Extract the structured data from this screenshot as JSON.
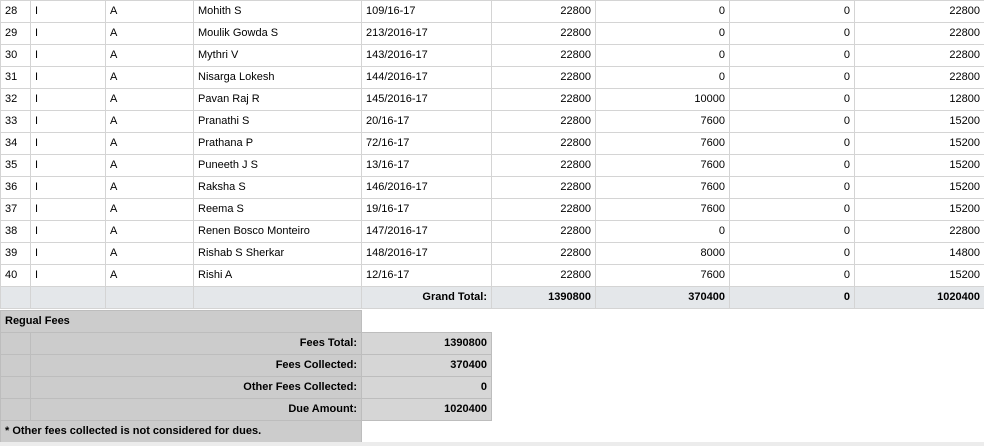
{
  "rows": [
    {
      "sl": "28",
      "cls": "I",
      "sec": "A",
      "name": "Mohith S",
      "adm": "109/16-17",
      "total": "22800",
      "paid": "0",
      "other": "0",
      "due": "22800"
    },
    {
      "sl": "29",
      "cls": "I",
      "sec": "A",
      "name": "Moulik Gowda S",
      "adm": "213/2016-17",
      "total": "22800",
      "paid": "0",
      "other": "0",
      "due": "22800"
    },
    {
      "sl": "30",
      "cls": "I",
      "sec": "A",
      "name": "Mythri V",
      "adm": "143/2016-17",
      "total": "22800",
      "paid": "0",
      "other": "0",
      "due": "22800"
    },
    {
      "sl": "31",
      "cls": "I",
      "sec": "A",
      "name": "Nisarga Lokesh",
      "adm": "144/2016-17",
      "total": "22800",
      "paid": "0",
      "other": "0",
      "due": "22800"
    },
    {
      "sl": "32",
      "cls": "I",
      "sec": "A",
      "name": "Pavan Raj R",
      "adm": "145/2016-17",
      "total": "22800",
      "paid": "10000",
      "other": "0",
      "due": "12800"
    },
    {
      "sl": "33",
      "cls": "I",
      "sec": "A",
      "name": "Pranathi S",
      "adm": "20/16-17",
      "total": "22800",
      "paid": "7600",
      "other": "0",
      "due": "15200"
    },
    {
      "sl": "34",
      "cls": "I",
      "sec": "A",
      "name": "Prathana P",
      "adm": "72/16-17",
      "total": "22800",
      "paid": "7600",
      "other": "0",
      "due": "15200"
    },
    {
      "sl": "35",
      "cls": "I",
      "sec": "A",
      "name": "Puneeth J S",
      "adm": "13/16-17",
      "total": "22800",
      "paid": "7600",
      "other": "0",
      "due": "15200"
    },
    {
      "sl": "36",
      "cls": "I",
      "sec": "A",
      "name": "Raksha S",
      "adm": "146/2016-17",
      "total": "22800",
      "paid": "7600",
      "other": "0",
      "due": "15200"
    },
    {
      "sl": "37",
      "cls": "I",
      "sec": "A",
      "name": "Reema S",
      "adm": "19/16-17",
      "total": "22800",
      "paid": "7600",
      "other": "0",
      "due": "15200"
    },
    {
      "sl": "38",
      "cls": "I",
      "sec": "A",
      "name": "Renen Bosco Monteiro",
      "adm": "147/2016-17",
      "total": "22800",
      "paid": "0",
      "other": "0",
      "due": "22800"
    },
    {
      "sl": "39",
      "cls": "I",
      "sec": "A",
      "name": "Rishab S Sherkar",
      "adm": "148/2016-17",
      "total": "22800",
      "paid": "8000",
      "other": "0",
      "due": "14800"
    },
    {
      "sl": "40",
      "cls": "I",
      "sec": "A",
      "name": "Rishi A",
      "adm": "12/16-17",
      "total": "22800",
      "paid": "7600",
      "other": "0",
      "due": "15200"
    }
  ],
  "grand_total": {
    "label": "Grand Total:",
    "total": "1390800",
    "paid": "370400",
    "other": "0",
    "due": "1020400"
  },
  "summary": {
    "title": "Regual Fees",
    "fees_total_label": "Fees Total:",
    "fees_total_value": "1390800",
    "fees_collected_label": "Fees Collected:",
    "fees_collected_value": "370400",
    "other_fees_label": "Other Fees Collected:",
    "other_fees_value": "0",
    "due_amount_label": "Due Amount:",
    "due_amount_value": "1020400",
    "note": "* Other fees collected is not considered for dues."
  }
}
